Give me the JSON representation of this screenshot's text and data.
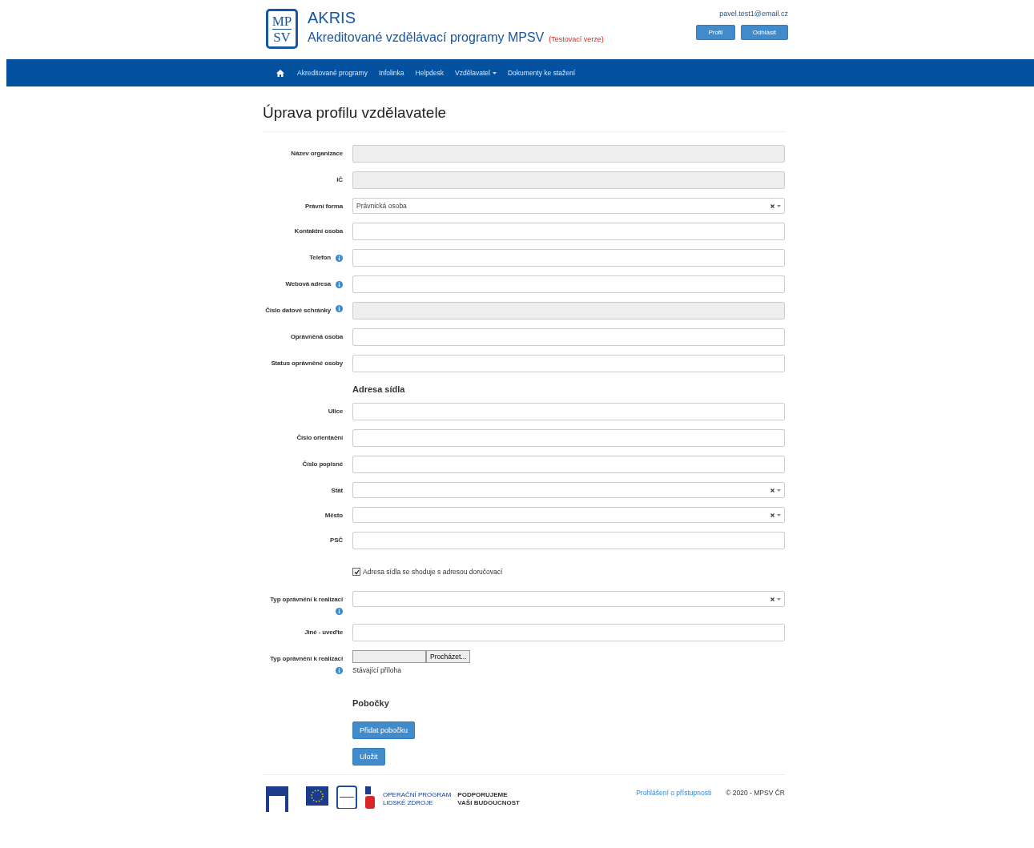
{
  "header": {
    "logo": [
      "MP",
      "SV"
    ],
    "title": "AKRIS",
    "subtitle": "Akreditované vzdělávací programy MPSV",
    "badge": "(Testovací verze)",
    "user_email": "pavel.test1@email.cz",
    "buttons": [
      "Profil",
      "Odhlásit"
    ]
  },
  "nav": {
    "items": [
      {
        "label": "Akreditované programy",
        "dropdown": false
      },
      {
        "label": "Infolinka",
        "dropdown": false
      },
      {
        "label": "Helpdesk",
        "dropdown": false
      },
      {
        "label": "Vzdělavatel",
        "dropdown": true
      },
      {
        "label": "Dokumenty ke stažení",
        "dropdown": false
      }
    ]
  },
  "page_title": "Úprava profilu vzdělavatele",
  "form": {
    "rows": [
      {
        "kind": "readonly",
        "label": "Název organizace",
        "info": false
      },
      {
        "kind": "readonly",
        "label": "IČ",
        "info": false
      },
      {
        "kind": "select",
        "label": "Právní forma",
        "info": false,
        "value": "Právnická osoba"
      },
      {
        "kind": "text",
        "label": "Kontaktní osoba",
        "info": false
      },
      {
        "kind": "text",
        "label": "Telefon",
        "info": true
      },
      {
        "kind": "text",
        "label": "Webová adresa",
        "info": true
      },
      {
        "kind": "readonly",
        "label": "Číslo datové schránky",
        "info": true
      },
      {
        "kind": "text",
        "label": "Oprávněná osoba",
        "info": false
      },
      {
        "kind": "text",
        "label": "Status oprávněné osoby",
        "info": false
      },
      {
        "kind": "heading",
        "label": "Adresa sídla"
      },
      {
        "kind": "text",
        "label": "Ulice",
        "info": false
      },
      {
        "kind": "text",
        "label": "Číslo orientační",
        "info": false
      },
      {
        "kind": "text",
        "label": "Číslo popisné",
        "info": false
      },
      {
        "kind": "select",
        "label": "Stát",
        "info": false
      },
      {
        "kind": "select",
        "label": "Město",
        "info": false
      },
      {
        "kind": "text",
        "label": "PSČ",
        "info": false
      },
      {
        "kind": "checkbox",
        "label": "Adresa sídla se shoduje s adresou doručovací",
        "checked": true
      },
      {
        "kind": "select",
        "label": "Typ oprávnění k realizaci",
        "info": true
      },
      {
        "kind": "text",
        "label": "Jiné - uveďte",
        "info": false
      },
      {
        "kind": "file",
        "label": "Typ oprávnění k realizaci",
        "info": true,
        "button": "Procházet...",
        "note": "Stávající příloha"
      },
      {
        "kind": "heading",
        "label": "Pobočky"
      },
      {
        "kind": "button",
        "label": "Přidat pobočku"
      },
      {
        "kind": "button",
        "label": "Uložit"
      }
    ]
  },
  "footer": {
    "logo_texts": [
      "OPERAČNÍ PROGRAM",
      "LIDSKÉ ZDROJE",
      "PODPORUJEME",
      "VAŠI BUDOUCNOST"
    ],
    "link": "Prohlášení o přístupnosti",
    "copyright": "© 2020 - MPSV ČR"
  }
}
